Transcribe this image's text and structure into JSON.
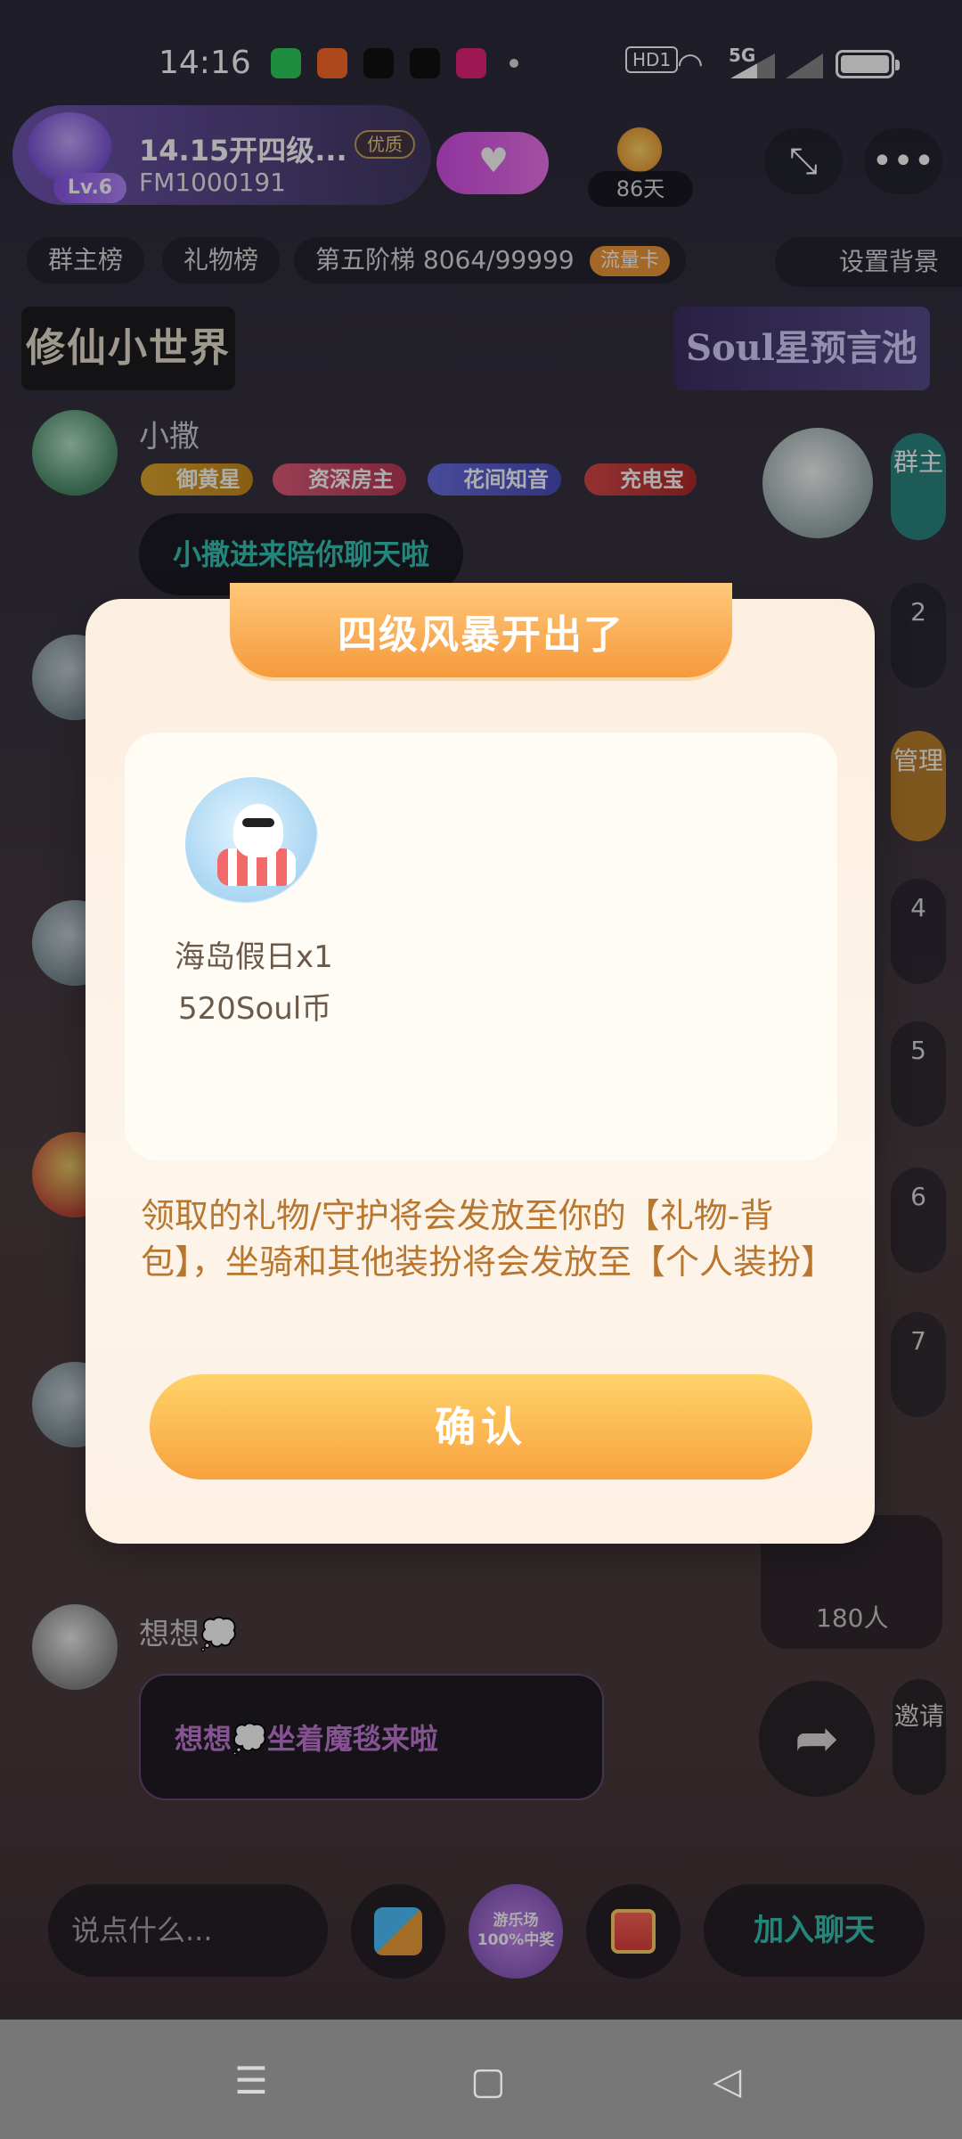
{
  "status_bar": {
    "time": "14:16",
    "network": "5G",
    "hd_label": "HD1"
  },
  "header": {
    "room_title": "14.15开四级...",
    "room_id": "FM1000191",
    "quality_tag": "优质",
    "level": "Lv.6",
    "days": "86天"
  },
  "pills": {
    "group_rank": "群主榜",
    "gift_rank": "礼物榜",
    "ladder": "第五阶梯 8064/99999",
    "flow_card": "流量卡",
    "set_background": "设置背景"
  },
  "banners": {
    "left": "修仙小世界",
    "right": "Soul星预言池"
  },
  "chat": {
    "user1_name": "小撒",
    "medals": [
      "御黄星",
      "资深房主",
      "花间知音",
      "充电宝"
    ],
    "user1_msg": "小撒进来陪你聊天啦",
    "user2_name": "想想💭",
    "user2_msg": "想想💭坐着魔毯来啦"
  },
  "seats": {
    "host_label": "群主",
    "manage_label": "管理",
    "numbers": [
      "2",
      "4",
      "5",
      "6",
      "7"
    ]
  },
  "audience": {
    "count": "180人"
  },
  "bottom": {
    "input_placeholder": "说点什么...",
    "join_label": "加入聊天",
    "invite_label": "邀请",
    "fun_badge": "游乐场 100%中奖"
  },
  "modal": {
    "title": "四级风暴开出了",
    "gift_name": "海岛假日x1",
    "gift_price": "520Soul币",
    "description": "领取的礼物/守护将会发放至你的【礼物-背包】，坐骑和其他装扮将会发放至【个人装扮】",
    "confirm_label": "确认"
  },
  "colors": {
    "accent_orange": "#f59a3b",
    "desc_text": "#b8762e",
    "join_teal": "#36c6b6"
  }
}
